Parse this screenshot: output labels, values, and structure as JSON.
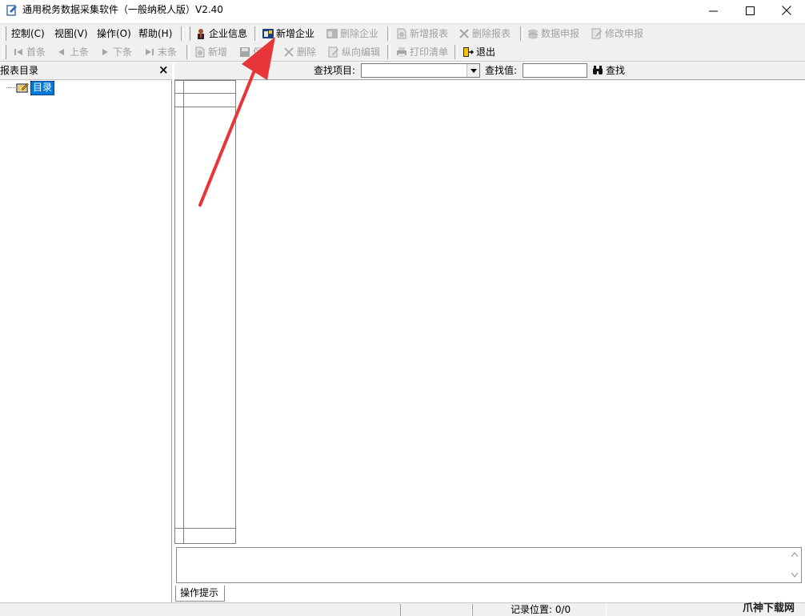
{
  "window": {
    "title": "通用税务数据采集软件（一般纳税人版）V2.40"
  },
  "menu": {
    "items": [
      "控制(C)",
      "视图(V)",
      "操作(O)",
      "帮助(H)"
    ]
  },
  "toolbar1": {
    "company_info": "企业信息",
    "add_company": "新增企业",
    "delete_company": "删除企业",
    "add_report": "新增报表",
    "delete_report": "删除报表",
    "data_declare": "数据申报",
    "modify_declare": "修改申报"
  },
  "toolbar2": {
    "first": "首条",
    "prev": "上条",
    "next": "下条",
    "last": "末条",
    "add": "新增",
    "save": "保存",
    "delete": "删除",
    "vertical_edit": "纵向编辑",
    "print_list": "打印清单",
    "exit": "退出"
  },
  "search": {
    "item_label": "查找项目:",
    "value_label": "查找值:",
    "find_button": "查找",
    "item_value": "",
    "value": ""
  },
  "left_panel": {
    "title": "报表目录",
    "close": "×",
    "tree_root": "目录"
  },
  "hint": {
    "tab_label": "操作提示"
  },
  "status": {
    "record_position": "记录位置: 0/0"
  },
  "watermark": "爪神下载网",
  "icons": [
    "app-icon",
    "minimize-icon",
    "maximize-icon",
    "close-icon",
    "company-icon",
    "add-company-icon",
    "delete-company-icon",
    "add-report-icon",
    "delete-report-icon",
    "data-declare-icon",
    "modify-declare-icon",
    "first-record-icon",
    "prev-record-icon",
    "next-record-icon",
    "last-record-icon",
    "add-icon",
    "save-icon",
    "delete-icon",
    "vertical-edit-icon",
    "print-icon",
    "exit-icon",
    "binoculars-icon",
    "folder-icon",
    "dropdown-arrow-icon",
    "scroll-up-icon",
    "scroll-down-icon",
    "annotation-arrow"
  ],
  "colors": {
    "annotation_arrow": "#e8353a",
    "selection": "#0078d7",
    "toolbar_bg": "#f0f0f0"
  }
}
